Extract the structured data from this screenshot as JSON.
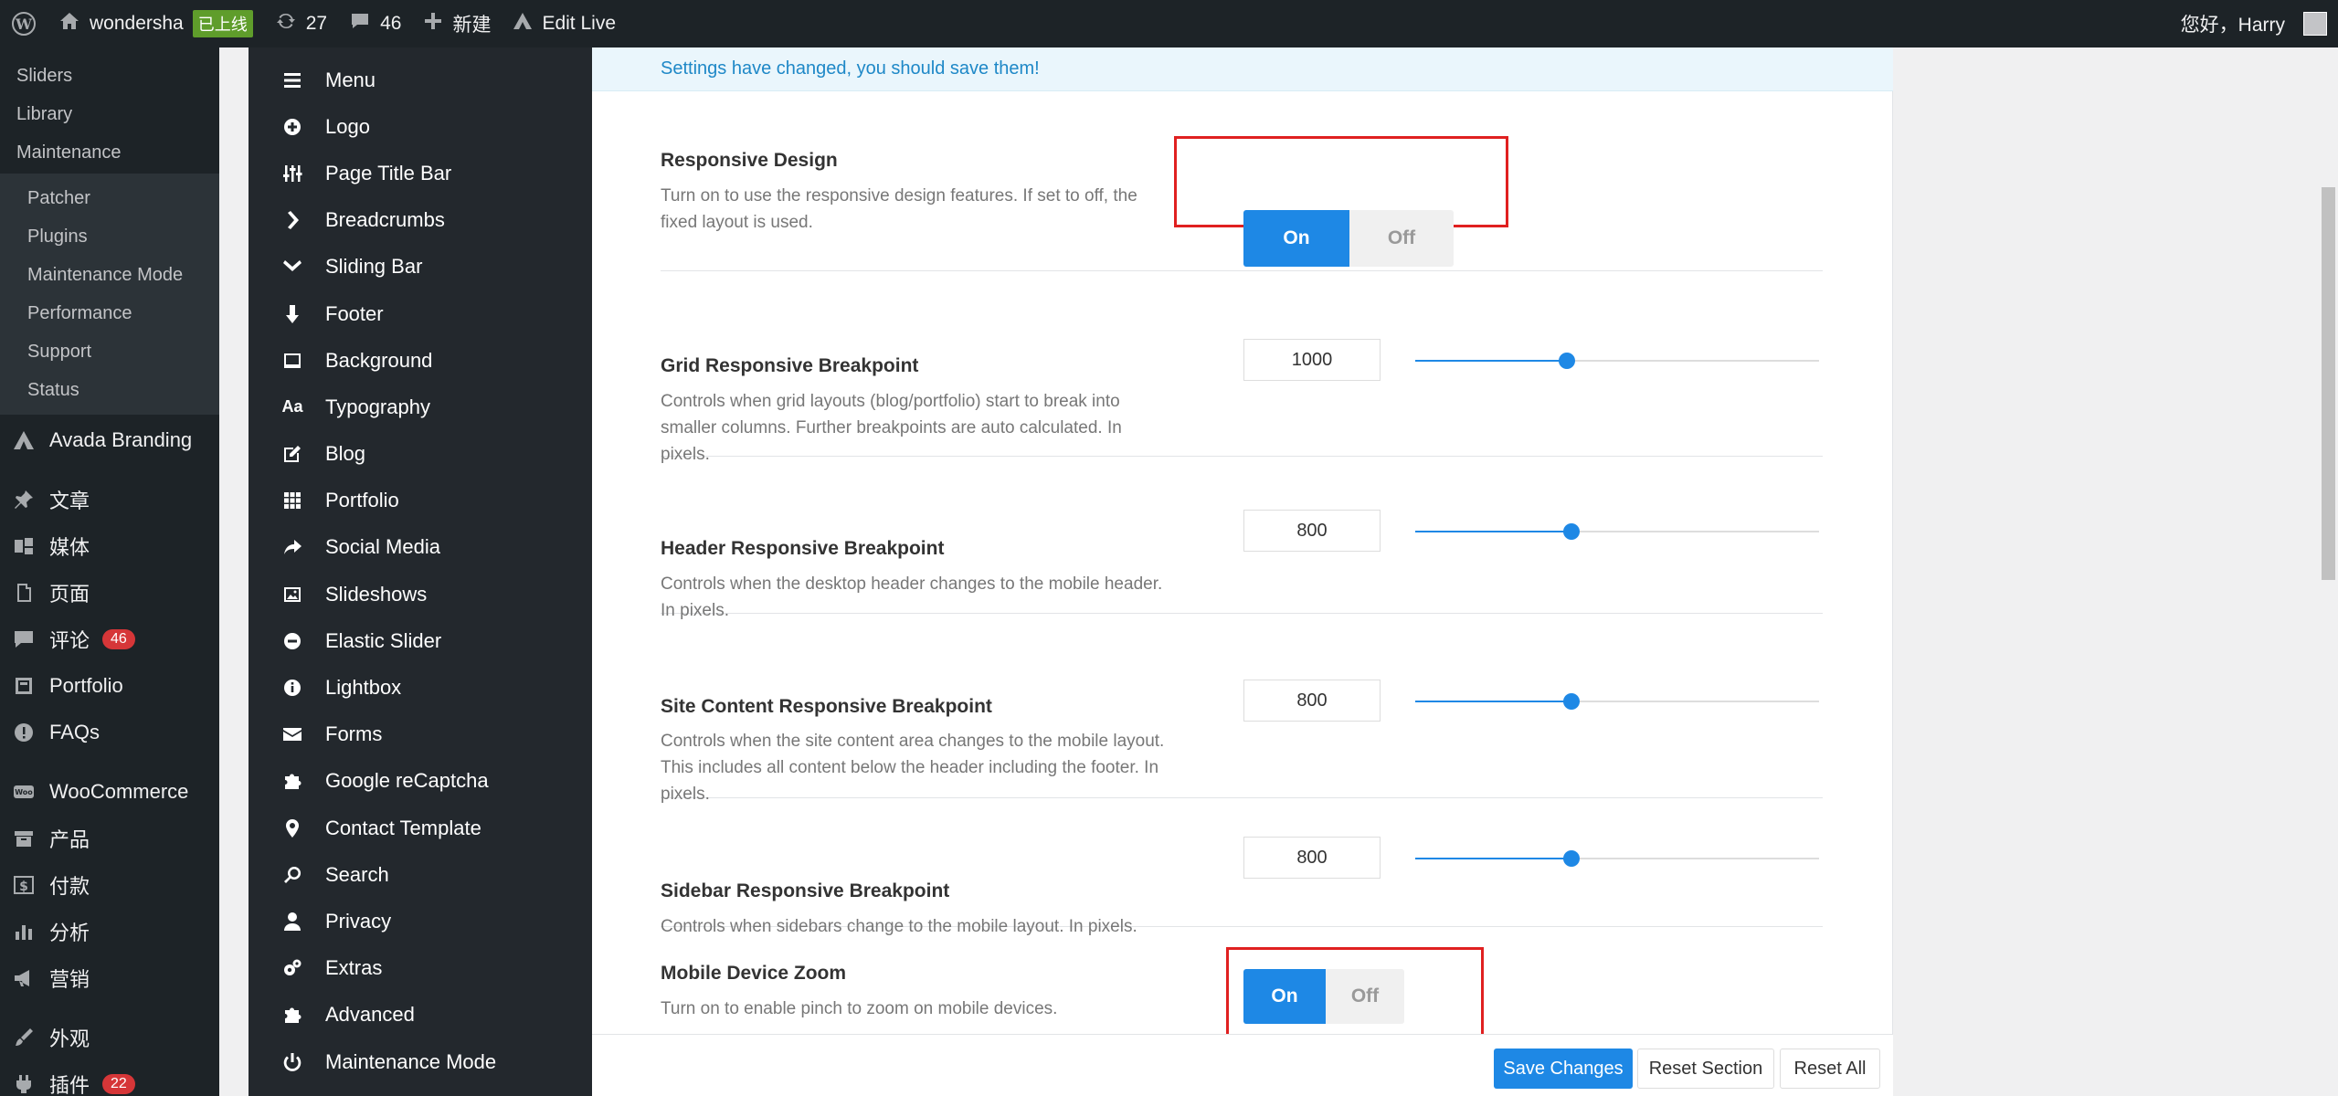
{
  "admin_bar": {
    "site_name": "wondersha",
    "site_status": "已上线",
    "updates_count": "27",
    "comments_count": "46",
    "new_label": "新建",
    "edit_live_label": "Edit Live",
    "greeting": "您好，Harry"
  },
  "admin_menu": {
    "top_subitems": [
      "Sliders",
      "Library",
      "Maintenance"
    ],
    "maintenance_subitems": [
      "Patcher",
      "Plugins",
      "Maintenance Mode",
      "Performance",
      "Support",
      "Status"
    ],
    "items": [
      {
        "label": "Avada Branding",
        "icon": "avada-icon"
      },
      {
        "label": "文章",
        "icon": "pin-icon"
      },
      {
        "label": "媒体",
        "icon": "media-icon"
      },
      {
        "label": "页面",
        "icon": "page-icon"
      },
      {
        "label": "评论",
        "icon": "comment-icon",
        "count": "46"
      },
      {
        "label": "Portfolio",
        "icon": "portfolio-icon"
      },
      {
        "label": "FAQs",
        "icon": "info-icon"
      },
      {
        "label": "WooCommerce",
        "icon": "woo-icon"
      },
      {
        "label": "产品",
        "icon": "archive-icon"
      },
      {
        "label": "付款",
        "icon": "dollar-icon"
      },
      {
        "label": "分析",
        "icon": "chart-icon"
      },
      {
        "label": "营销",
        "icon": "megaphone-icon"
      },
      {
        "label": "外观",
        "icon": "appearance-icon"
      },
      {
        "label": "插件",
        "icon": "plugin-icon",
        "count": "22"
      }
    ]
  },
  "avada_nav": {
    "items": [
      {
        "label": "Menu",
        "icon": "menu-icon"
      },
      {
        "label": "Logo",
        "icon": "plus-circle-icon"
      },
      {
        "label": "Page Title Bar",
        "icon": "sliders-icon"
      },
      {
        "label": "Breadcrumbs",
        "icon": "chevron-right-icon"
      },
      {
        "label": "Sliding Bar",
        "icon": "chevron-down-icon"
      },
      {
        "label": "Footer",
        "icon": "arrow-down-icon"
      },
      {
        "label": "Background",
        "icon": "monitor-icon"
      },
      {
        "label": "Typography",
        "icon": "typography-icon"
      },
      {
        "label": "Blog",
        "icon": "edit-icon"
      },
      {
        "label": "Portfolio",
        "icon": "grid-icon"
      },
      {
        "label": "Social Media",
        "icon": "share-icon"
      },
      {
        "label": "Slideshows",
        "icon": "image-icon"
      },
      {
        "label": "Elastic Slider",
        "icon": "minus-circle-icon"
      },
      {
        "label": "Lightbox",
        "icon": "info-circle-icon"
      },
      {
        "label": "Forms",
        "icon": "envelope-icon"
      },
      {
        "label": "Google reCaptcha",
        "icon": "puzzle-icon"
      },
      {
        "label": "Contact Template",
        "icon": "map-marker-icon"
      },
      {
        "label": "Search",
        "icon": "search-icon"
      },
      {
        "label": "Privacy",
        "icon": "user-icon"
      },
      {
        "label": "Extras",
        "icon": "cogs-icon"
      },
      {
        "label": "Advanced",
        "icon": "puzzle-icon"
      },
      {
        "label": "Maintenance Mode",
        "icon": "power-icon"
      }
    ]
  },
  "notice": "Settings have changed, you should save them!",
  "settings": {
    "responsive_design": {
      "title": "Responsive Design",
      "desc": "Turn on to use the responsive design features. If set to off, the fixed layout is used.",
      "on": "On",
      "off": "Off",
      "value": "On"
    },
    "grid_breakpoint": {
      "title": "Grid Responsive Breakpoint",
      "desc": "Controls when grid layouts (blog/portfolio) start to break into smaller columns. Further breakpoints are auto calculated. In pixels.",
      "value": "1000",
      "slider_fraction": 0.375
    },
    "header_breakpoint": {
      "title": "Header Responsive Breakpoint",
      "desc": "Controls when the desktop header changes to the mobile header. In pixels.",
      "value": "800",
      "slider_fraction": 0.387
    },
    "content_breakpoint": {
      "title": "Site Content Responsive Breakpoint",
      "desc": "Controls when the site content area changes to the mobile layout. This includes all content below the header including the footer. In pixels.",
      "value": "800",
      "slider_fraction": 0.387
    },
    "sidebar_breakpoint": {
      "title": "Sidebar Responsive Breakpoint",
      "desc": "Controls when sidebars change to the mobile layout. In pixels.",
      "value": "800",
      "slider_fraction": 0.387
    },
    "mobile_zoom": {
      "title": "Mobile Device Zoom",
      "desc": "Turn on to enable pinch to zoom on mobile devices.",
      "on": "On",
      "off": "Off",
      "value": "On"
    }
  },
  "buttons": {
    "save": "Save Changes",
    "reset_section": "Reset Section",
    "reset_all": "Reset All"
  },
  "colors": {
    "accent": "#1e88e5",
    "admin_bg": "#1d2327",
    "highlight_box": "#e02020"
  }
}
